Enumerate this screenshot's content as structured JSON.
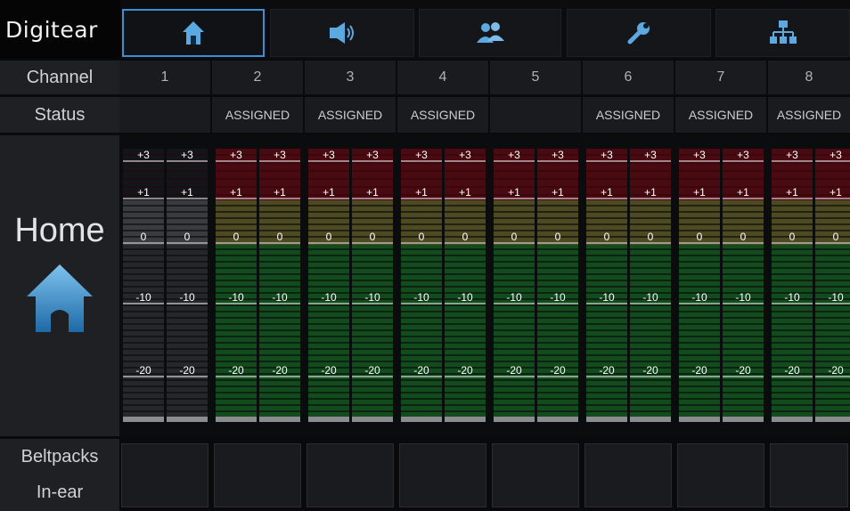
{
  "app": {
    "logo_text": "Digitear",
    "brand_color": "#3a8fd6"
  },
  "nav": {
    "tabs": [
      {
        "icon": "home-icon",
        "active": true
      },
      {
        "icon": "speaker-icon",
        "active": false
      },
      {
        "icon": "users-icon",
        "active": false
      },
      {
        "icon": "wrench-icon",
        "active": false
      },
      {
        "icon": "network-icon",
        "active": false
      }
    ]
  },
  "sidebar": {
    "channel_label": "Channel",
    "status_label": "Status",
    "home_label": "Home",
    "home_icon": "home-icon",
    "beltpacks_label": "Beltpacks",
    "inear_label": "In-ear"
  },
  "channels": [
    {
      "number": "1",
      "status": "",
      "assigned": false
    },
    {
      "number": "2",
      "status": "ASSIGNED",
      "assigned": true
    },
    {
      "number": "3",
      "status": "ASSIGNED",
      "assigned": true
    },
    {
      "number": "4",
      "status": "ASSIGNED",
      "assigned": true
    },
    {
      "number": "5",
      "status": "",
      "assigned": true
    },
    {
      "number": "6",
      "status": "ASSIGNED",
      "assigned": true
    },
    {
      "number": "7",
      "status": "ASSIGNED",
      "assigned": true
    },
    {
      "number": "8",
      "status": "ASSIGNED",
      "assigned": true
    }
  ],
  "meter": {
    "scale_labels": [
      "+3",
      "+1",
      "0",
      "-10",
      "-20"
    ],
    "colors": {
      "red": "#4a0a12",
      "yellow": "#4d4a22",
      "green": "#124b1c",
      "inactive": "#26272b",
      "segment_line": "#0a0b0d"
    }
  }
}
